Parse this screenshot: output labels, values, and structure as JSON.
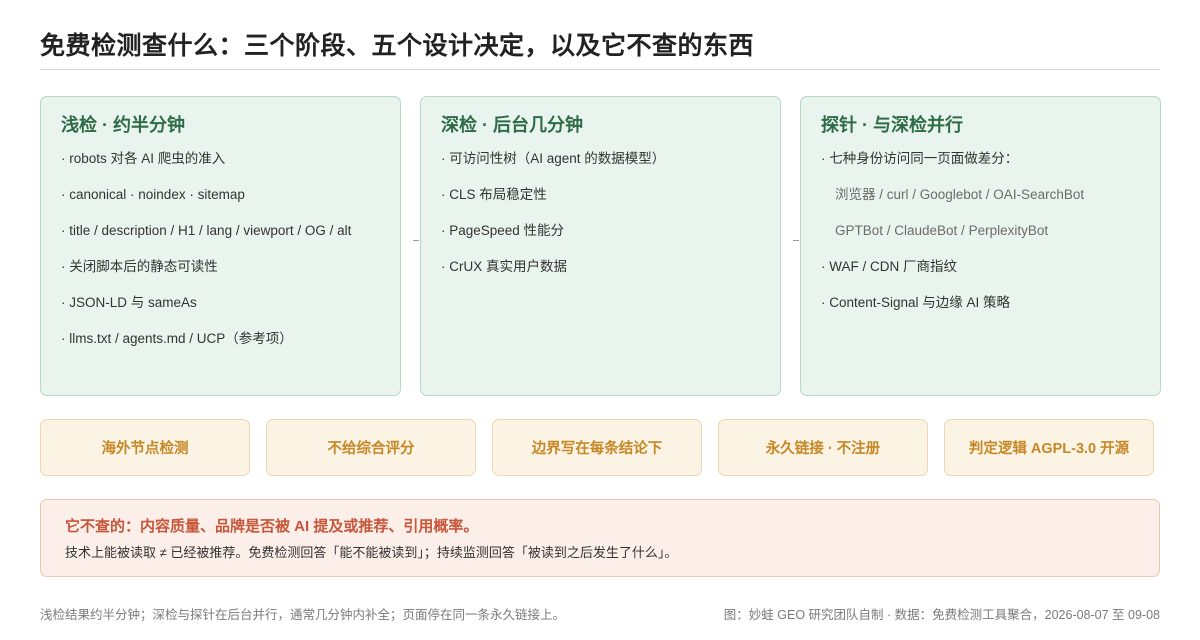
{
  "title": "免费检测查什么：三个阶段、五个设计决定，以及它不查的东西",
  "stages": [
    {
      "title": "浅检 · 约半分钟",
      "items": [
        "· robots 对各 AI 爬虫的准入",
        "· canonical · noindex · sitemap",
        "· title / description / H1 / lang / viewport / OG / alt",
        "· 关闭脚本后的静态可读性",
        "· JSON-LD 与 sameAs",
        "· llms.txt / agents.md / UCP（参考项）"
      ]
    },
    {
      "title": "深检 · 后台几分钟",
      "items": [
        "· 可访问性树（AI agent 的数据模型）",
        "· CLS 布局稳定性",
        "· PageSpeed 性能分",
        "· CrUX 真实用户数据"
      ]
    },
    {
      "title": "探针 · 与深检并行",
      "items": [
        "· 七种身份访问同一页面做差分：",
        "浏览器 / curl / Googlebot / OAI-SearchBot",
        "GPTBot / ClaudeBot / PerplexityBot",
        "· WAF / CDN 厂商指纹",
        "· Content-Signal 与边缘 AI 策略"
      ]
    }
  ],
  "decisions": [
    "海外节点检测",
    "不给综合评分",
    "边界写在每条结论下",
    "永久链接 · 不注册",
    "判定逻辑 AGPL-3.0 开源"
  ],
  "exclusion": {
    "heading": "它不查的：内容质量、品牌是否被 AI 提及或推荐、引用概率。",
    "body": "技术上能被读取 ≠ 已经被推荐。免费检测回答「能不能被读到」；持续监测回答「被读到之后发生了什么」。"
  },
  "footer": {
    "note": "浅检结果约半分钟；深检与探针在后台并行，通常几分钟内补全；页面停在同一条永久链接上。",
    "source": "图：妙蛙 GEO 研究团队自制 · 数据：免费检测工具聚合，2026-08-07 至 09-08"
  },
  "colors": {
    "stage_bg": "#eaf4ee",
    "stage_title": "#2e6b48",
    "decision_bg": "#fbf3e4",
    "decision_text": "#c68826",
    "exclusion_bg": "#fcefe9",
    "exclusion_heading": "#c8563a"
  }
}
